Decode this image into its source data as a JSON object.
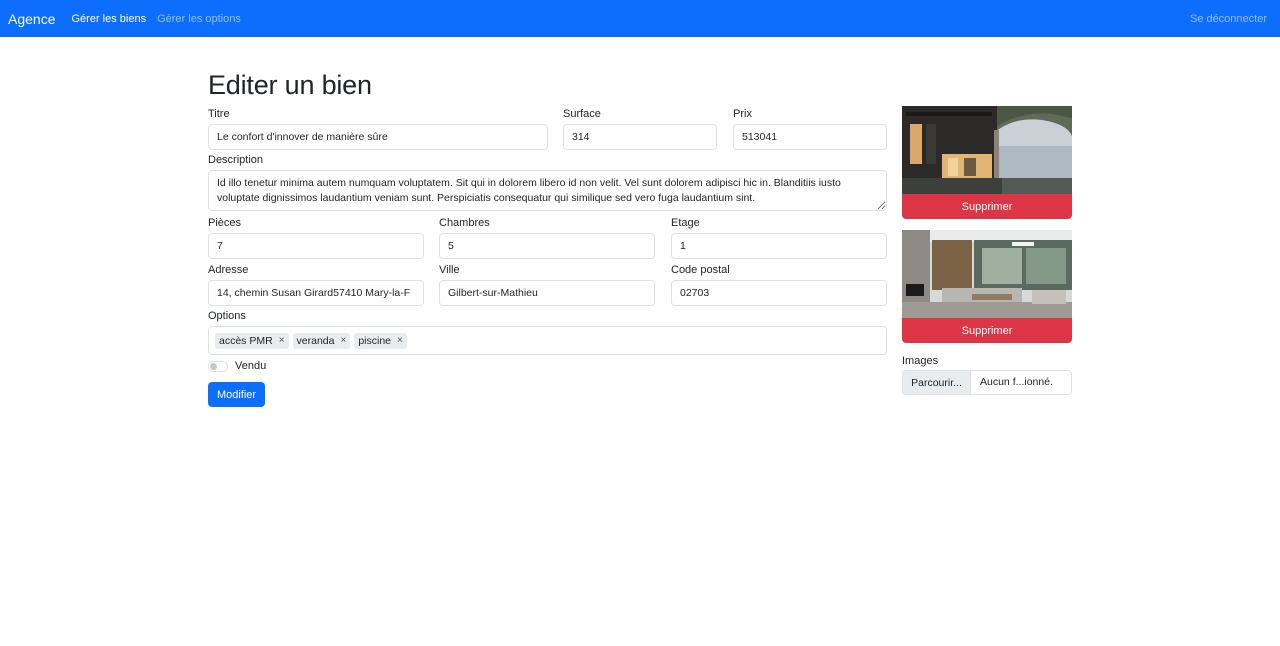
{
  "nav": {
    "brand": "Agence",
    "links": [
      "Gérer les biens",
      "Gérer les options"
    ],
    "logout": "Se déconnecter"
  },
  "page": {
    "title": "Editer un bien"
  },
  "form": {
    "titre": {
      "label": "Titre",
      "value": "Le confort d'innover de manière sûre"
    },
    "surface": {
      "label": "Surface",
      "value": "314"
    },
    "prix": {
      "label": "Prix",
      "value": "513041"
    },
    "description": {
      "label": "Description",
      "value": "Id illo tenetur minima autem numquam voluptatem. Sit qui in dolorem libero id non velit. Vel sunt dolorem adipisci hic in. Blanditiis iusto voluptate dignissimos laudantium veniam sunt. Perspiciatis consequatur qui similique sed vero fuga laudantium sint."
    },
    "pieces": {
      "label": "Pièces",
      "value": "7"
    },
    "chambres": {
      "label": "Chambres",
      "value": "5"
    },
    "etage": {
      "label": "Etage",
      "value": "1"
    },
    "adresse": {
      "label": "Adresse",
      "value": "14, chemin Susan Girard57410 Mary-la-F"
    },
    "ville": {
      "label": "Ville",
      "value": "Gilbert-sur-Mathieu"
    },
    "code_postal": {
      "label": "Code postal",
      "value": "02703"
    },
    "options": {
      "label": "Options",
      "tags": [
        "accès PMR",
        "veranda",
        "piscine"
      ],
      "remove_glyph": "×"
    },
    "vendu": {
      "label": "Vendu",
      "checked": false
    },
    "submit": "Modifier"
  },
  "images": {
    "photos": [
      {
        "delete_label": "Supprimer"
      },
      {
        "delete_label": "Supprimer"
      }
    ],
    "label": "Images",
    "browse": "Parcourir...",
    "file_text": "Aucun f...ionné."
  },
  "colors": {
    "primary": "#0d6efd",
    "danger": "#dc3545"
  }
}
